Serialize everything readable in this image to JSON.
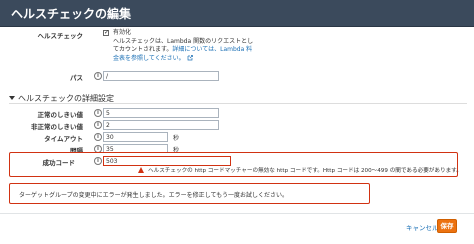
{
  "header": {
    "title": "ヘルスチェックの編集"
  },
  "health_check": {
    "label": "ヘルスチェック",
    "checkbox_label": "有効化",
    "description_line1": "ヘルスチェックは、Lambda 関数のリクエストとし",
    "description_line2_prefix": "てカウントされます。",
    "link_text_1": "詳細については、Lambda 料",
    "link_text_2": "金表を参照してください。",
    "checked_mark": "✓"
  },
  "path": {
    "label": "パス",
    "value": "/"
  },
  "advanced": {
    "section_title": "ヘルスチェックの詳細設定",
    "healthy_threshold": {
      "label": "正常のしきい値",
      "value": "5"
    },
    "unhealthy_threshold": {
      "label": "非正常のしきい値",
      "value": "2"
    },
    "timeout": {
      "label": "タイムアウト",
      "value": "30",
      "unit": "秒"
    },
    "interval": {
      "label": "間隔",
      "value": "35",
      "unit": "秒"
    },
    "success_codes": {
      "label": "成功コード",
      "value": "503",
      "error": "ヘルスチェックの http コードマッチャーの無効な http コードです。Http コードは 200〜499 の間である必要があります。"
    }
  },
  "banner": {
    "message": "ターゲットグループの変更中にエラーが発生しました。エラーを修正してもう一度お試しください。"
  },
  "footer": {
    "cancel_label": "キャンセル",
    "save_label": "保存"
  },
  "info_glyph": "i",
  "colors": {
    "header_bg": "#3b4a5c",
    "error": "#d13212",
    "primary": "#ec7211",
    "link": "#1a6fb5"
  }
}
